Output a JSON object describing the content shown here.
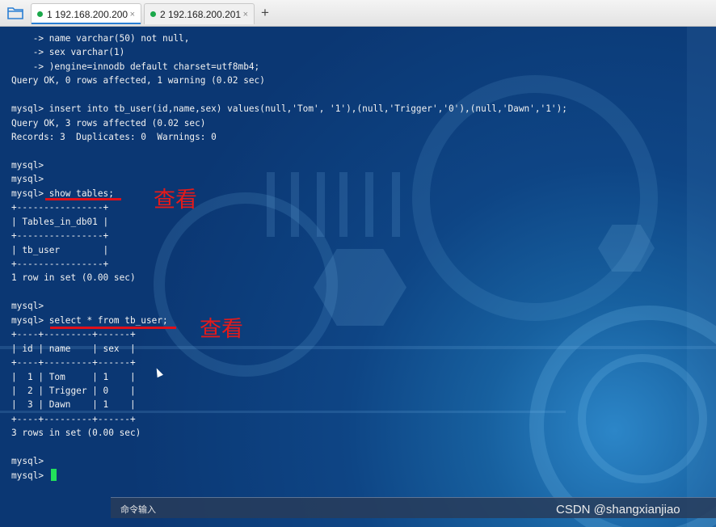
{
  "tabs": [
    {
      "label": "1 192.168.200.200",
      "close": "×"
    },
    {
      "label": "2 192.168.200.201",
      "close": "×"
    }
  ],
  "add_tab": "+",
  "terminal_lines": [
    "    -> name varchar(50) not null,",
    "    -> sex varchar(1)",
    "    -> )engine=innodb default charset=utf8mb4;",
    "Query OK, 0 rows affected, 1 warning (0.02 sec)",
    "",
    "mysql> insert into tb_user(id,name,sex) values(null,'Tom', '1'),(null,'Trigger','0'),(null,'Dawn','1');",
    "Query OK, 3 rows affected (0.02 sec)",
    "Records: 3  Duplicates: 0  Warnings: 0",
    "",
    "mysql>",
    "mysql>",
    "mysql> show tables;",
    "+----------------+",
    "| Tables_in_db01 |",
    "+----------------+",
    "| tb_user        |",
    "+----------------+",
    "1 row in set (0.00 sec)",
    "",
    "mysql>",
    "mysql> select * from tb_user;",
    "+----+---------+------+",
    "| id | name    | sex  |",
    "+----+---------+------+",
    "|  1 | Tom     | 1    |",
    "|  2 | Trigger | 0    |",
    "|  3 | Dawn    | 1    |",
    "+----+---------+------+",
    "3 rows in set (0.00 sec)",
    "",
    "mysql>",
    "mysql> "
  ],
  "annotations": {
    "note1": "查看",
    "note2": "查看",
    "color": "#e0101a"
  },
  "command_bar": {
    "label": "命令输入"
  },
  "watermark": "CSDN @shangxianjiao",
  "colors": {
    "tab_dot": "#1aa84a",
    "cursor": "#22e05a",
    "terminal_text": "#f2f2f2"
  }
}
